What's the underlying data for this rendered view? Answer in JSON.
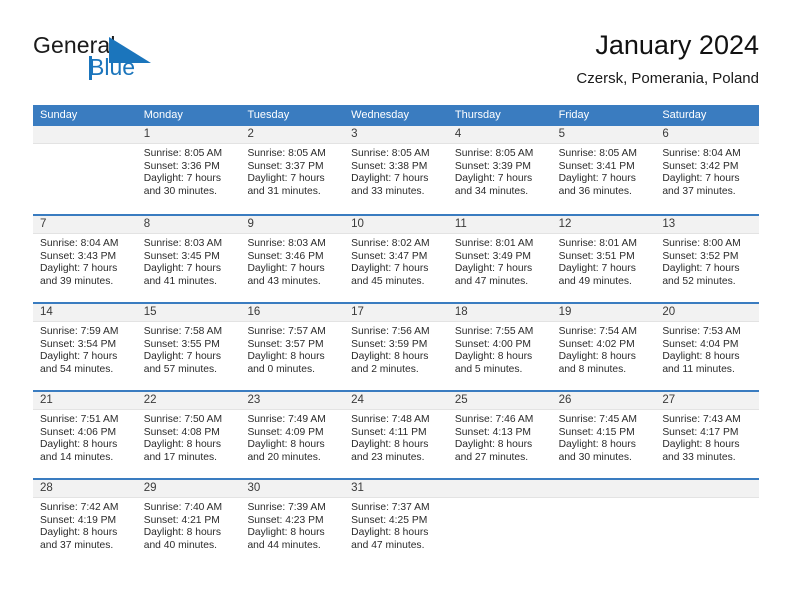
{
  "brand": {
    "name_part1": "General",
    "name_part2": "Blue",
    "accent_color": "#1b75bc"
  },
  "header": {
    "title": "January 2024",
    "location": "Czersk, Pomerania, Poland"
  },
  "calendar": {
    "header_bg": "#3a7cc0",
    "daynum_bg": "#f2f2f2",
    "weekday_headers": [
      "Sunday",
      "Monday",
      "Tuesday",
      "Wednesday",
      "Thursday",
      "Friday",
      "Saturday"
    ],
    "weeks": [
      [
        {
          "day": "",
          "lines": []
        },
        {
          "day": "1",
          "lines": [
            "Sunrise: 8:05 AM",
            "Sunset: 3:36 PM",
            "Daylight: 7 hours",
            "and 30 minutes."
          ]
        },
        {
          "day": "2",
          "lines": [
            "Sunrise: 8:05 AM",
            "Sunset: 3:37 PM",
            "Daylight: 7 hours",
            "and 31 minutes."
          ]
        },
        {
          "day": "3",
          "lines": [
            "Sunrise: 8:05 AM",
            "Sunset: 3:38 PM",
            "Daylight: 7 hours",
            "and 33 minutes."
          ]
        },
        {
          "day": "4",
          "lines": [
            "Sunrise: 8:05 AM",
            "Sunset: 3:39 PM",
            "Daylight: 7 hours",
            "and 34 minutes."
          ]
        },
        {
          "day": "5",
          "lines": [
            "Sunrise: 8:05 AM",
            "Sunset: 3:41 PM",
            "Daylight: 7 hours",
            "and 36 minutes."
          ]
        },
        {
          "day": "6",
          "lines": [
            "Sunrise: 8:04 AM",
            "Sunset: 3:42 PM",
            "Daylight: 7 hours",
            "and 37 minutes."
          ]
        }
      ],
      [
        {
          "day": "7",
          "lines": [
            "Sunrise: 8:04 AM",
            "Sunset: 3:43 PM",
            "Daylight: 7 hours",
            "and 39 minutes."
          ]
        },
        {
          "day": "8",
          "lines": [
            "Sunrise: 8:03 AM",
            "Sunset: 3:45 PM",
            "Daylight: 7 hours",
            "and 41 minutes."
          ]
        },
        {
          "day": "9",
          "lines": [
            "Sunrise: 8:03 AM",
            "Sunset: 3:46 PM",
            "Daylight: 7 hours",
            "and 43 minutes."
          ]
        },
        {
          "day": "10",
          "lines": [
            "Sunrise: 8:02 AM",
            "Sunset: 3:47 PM",
            "Daylight: 7 hours",
            "and 45 minutes."
          ]
        },
        {
          "day": "11",
          "lines": [
            "Sunrise: 8:01 AM",
            "Sunset: 3:49 PM",
            "Daylight: 7 hours",
            "and 47 minutes."
          ]
        },
        {
          "day": "12",
          "lines": [
            "Sunrise: 8:01 AM",
            "Sunset: 3:51 PM",
            "Daylight: 7 hours",
            "and 49 minutes."
          ]
        },
        {
          "day": "13",
          "lines": [
            "Sunrise: 8:00 AM",
            "Sunset: 3:52 PM",
            "Daylight: 7 hours",
            "and 52 minutes."
          ]
        }
      ],
      [
        {
          "day": "14",
          "lines": [
            "Sunrise: 7:59 AM",
            "Sunset: 3:54 PM",
            "Daylight: 7 hours",
            "and 54 minutes."
          ]
        },
        {
          "day": "15",
          "lines": [
            "Sunrise: 7:58 AM",
            "Sunset: 3:55 PM",
            "Daylight: 7 hours",
            "and 57 minutes."
          ]
        },
        {
          "day": "16",
          "lines": [
            "Sunrise: 7:57 AM",
            "Sunset: 3:57 PM",
            "Daylight: 8 hours",
            "and 0 minutes."
          ]
        },
        {
          "day": "17",
          "lines": [
            "Sunrise: 7:56 AM",
            "Sunset: 3:59 PM",
            "Daylight: 8 hours",
            "and 2 minutes."
          ]
        },
        {
          "day": "18",
          "lines": [
            "Sunrise: 7:55 AM",
            "Sunset: 4:00 PM",
            "Daylight: 8 hours",
            "and 5 minutes."
          ]
        },
        {
          "day": "19",
          "lines": [
            "Sunrise: 7:54 AM",
            "Sunset: 4:02 PM",
            "Daylight: 8 hours",
            "and 8 minutes."
          ]
        },
        {
          "day": "20",
          "lines": [
            "Sunrise: 7:53 AM",
            "Sunset: 4:04 PM",
            "Daylight: 8 hours",
            "and 11 minutes."
          ]
        }
      ],
      [
        {
          "day": "21",
          "lines": [
            "Sunrise: 7:51 AM",
            "Sunset: 4:06 PM",
            "Daylight: 8 hours",
            "and 14 minutes."
          ]
        },
        {
          "day": "22",
          "lines": [
            "Sunrise: 7:50 AM",
            "Sunset: 4:08 PM",
            "Daylight: 8 hours",
            "and 17 minutes."
          ]
        },
        {
          "day": "23",
          "lines": [
            "Sunrise: 7:49 AM",
            "Sunset: 4:09 PM",
            "Daylight: 8 hours",
            "and 20 minutes."
          ]
        },
        {
          "day": "24",
          "lines": [
            "Sunrise: 7:48 AM",
            "Sunset: 4:11 PM",
            "Daylight: 8 hours",
            "and 23 minutes."
          ]
        },
        {
          "day": "25",
          "lines": [
            "Sunrise: 7:46 AM",
            "Sunset: 4:13 PM",
            "Daylight: 8 hours",
            "and 27 minutes."
          ]
        },
        {
          "day": "26",
          "lines": [
            "Sunrise: 7:45 AM",
            "Sunset: 4:15 PM",
            "Daylight: 8 hours",
            "and 30 minutes."
          ]
        },
        {
          "day": "27",
          "lines": [
            "Sunrise: 7:43 AM",
            "Sunset: 4:17 PM",
            "Daylight: 8 hours",
            "and 33 minutes."
          ]
        }
      ],
      [
        {
          "day": "28",
          "lines": [
            "Sunrise: 7:42 AM",
            "Sunset: 4:19 PM",
            "Daylight: 8 hours",
            "and 37 minutes."
          ]
        },
        {
          "day": "29",
          "lines": [
            "Sunrise: 7:40 AM",
            "Sunset: 4:21 PM",
            "Daylight: 8 hours",
            "and 40 minutes."
          ]
        },
        {
          "day": "30",
          "lines": [
            "Sunrise: 7:39 AM",
            "Sunset: 4:23 PM",
            "Daylight: 8 hours",
            "and 44 minutes."
          ]
        },
        {
          "day": "31",
          "lines": [
            "Sunrise: 7:37 AM",
            "Sunset: 4:25 PM",
            "Daylight: 8 hours",
            "and 47 minutes."
          ]
        },
        {
          "day": "",
          "lines": []
        },
        {
          "day": "",
          "lines": []
        },
        {
          "day": "",
          "lines": []
        }
      ]
    ]
  }
}
